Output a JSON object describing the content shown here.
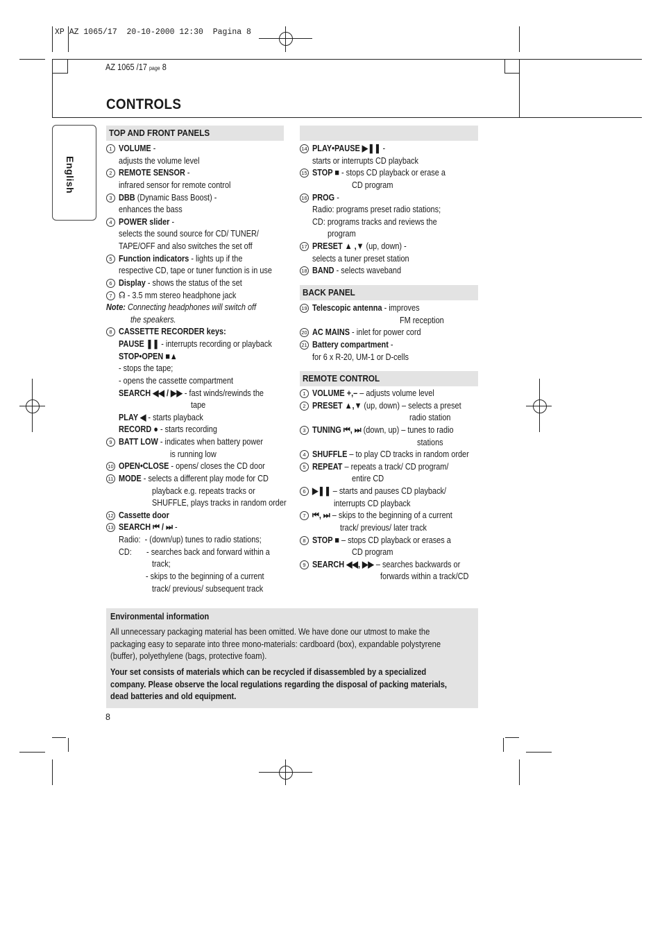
{
  "slug": "XP AZ 1065/17  20-10-2000 12:30  Pagina 8",
  "page_ref": {
    "model": "AZ 1065 /17 ",
    "page_word": "page",
    "page": " 8"
  },
  "title": "CONTROLS",
  "language_tab": "English",
  "left": {
    "header": "TOP AND FRONT PANELS",
    "lines": [
      {
        "n": "1",
        "b": "VOLUME",
        "t": " -"
      },
      {
        "t": "adjusts the volume level"
      },
      {
        "n": "2",
        "b": "REMOTE SENSOR",
        "t": " -"
      },
      {
        "t": "infrared sensor for remote control"
      },
      {
        "n": "3",
        "b": "DBB",
        "t": " (Dynamic Bass Boost) -"
      },
      {
        "t": "enhances the bass"
      },
      {
        "n": "4",
        "b": "POWER slider",
        "t": " -"
      },
      {
        "t": "selects the sound source for CD/ TUNER/"
      },
      {
        "t": "TAPE/OFF and also switches the set off"
      },
      {
        "n": "5",
        "b": "Function indicators",
        "t": " - lights up if the"
      },
      {
        "t": "respective CD, tape or tuner function is in use"
      },
      {
        "n": "6",
        "b": "Display",
        "t": " - shows the status of the set"
      },
      {
        "n": "7",
        "t": "☊ - 3.5 mm stereo headphone jack"
      },
      {
        "note": true,
        "b": "Note:",
        "t": " Connecting headphones will switch off"
      },
      {
        "ind": 17,
        "it": true,
        "t": "the speakers."
      },
      {
        "n": "8",
        "b": "CASSETTE RECORDER keys:"
      },
      {
        "b": "PAUSE ❚❚",
        "t": " - interrupts recording or playback"
      },
      {
        "b": "STOP•OPEN ■▲"
      },
      {
        "t": "- stops the tape;"
      },
      {
        "t": "- opens the cassette compartment"
      },
      {
        "b": "SEARCH ◀◀ / ▶▶",
        "t": " - fast winds/rewinds the"
      },
      {
        "ind": 104,
        "t": "tape"
      },
      {
        "b": "PLAY ◀",
        "t": " - starts playback"
      },
      {
        "b": "RECORD ●",
        "t": " - starts recording"
      },
      {
        "n": "9",
        "b": "BATT LOW",
        "t": " - indicates when battery power"
      },
      {
        "ind": 74,
        "t": "is running low"
      },
      {
        "n": "10",
        "b": "OPEN•CLOSE",
        "t": " - opens/ closes the CD door"
      },
      {
        "n": "11",
        "b": "MODE",
        "t": " - selects a different play mode for CD"
      },
      {
        "ind": 48,
        "t": "playback e.g. repeats tracks or"
      },
      {
        "ind": 48,
        "t": "SHUFFLE, plays tracks in random order"
      },
      {
        "n": "12",
        "b": "Cassette door"
      },
      {
        "n": "13",
        "b": "SEARCH ⏮ / ⏭",
        "t": " -"
      },
      {
        "t": "Radio:  - (down/up) tunes to radio stations;"
      },
      {
        "t": "CD:       - searches back and forward within a"
      },
      {
        "ind": 48,
        "t": "track;"
      },
      {
        "ind": 39,
        "t": "- skips to the beginning of a current"
      },
      {
        "ind": 48,
        "t": "track/ previous/ subsequent track"
      }
    ]
  },
  "right": {
    "header": "",
    "lines": [
      {
        "n": "14",
        "b": "PLAY•PAUSE ▶❚❚",
        "t": " -"
      },
      {
        "t": "starts or interrupts CD playback"
      },
      {
        "n": "15",
        "b": "STOP ■",
        "t": " - stops CD playback or erase a"
      },
      {
        "ind": 57,
        "t": "CD program"
      },
      {
        "n": "16",
        "b": "PROG",
        "t": " -"
      },
      {
        "t": "Radio: programs preset radio stations;"
      },
      {
        "t": "CD: programs tracks and reviews the"
      },
      {
        "ind": 22,
        "t": "program"
      },
      {
        "n": "17",
        "b": "PRESET ▲ ,▼",
        "t": " (up, down) -"
      },
      {
        "t": "selects a tuner preset station"
      },
      {
        "n": "18",
        "b": "BAND",
        "t": " - selects waveband"
      }
    ]
  },
  "back": {
    "header": "BACK PANEL",
    "lines": [
      {
        "n": "19",
        "b": "Telescopic antenna",
        "t": " - improves"
      },
      {
        "ind": 126,
        "t": "FM reception"
      },
      {
        "n": "20",
        "b": "AC MAINS",
        "t": " - inlet for power cord"
      },
      {
        "n": "21",
        "b": "Battery compartment",
        "t": " -"
      },
      {
        "t": "for 6 x R-20, UM-1 or D-cells"
      }
    ]
  },
  "remote": {
    "header": "REMOTE CONTROL",
    "lines": [
      {
        "n": "1",
        "b": "VOLUME +,–",
        "t": " – adjusts volume level"
      },
      {
        "n": "2",
        "b": "PRESET ▲,▼",
        "t": " (up, down) – selects a preset"
      },
      {
        "ind": 140,
        "t": "radio station"
      },
      {
        "n": "3",
        "b": "TUNING ⏮, ⏭",
        "t": " (down, up) – tunes to radio"
      },
      {
        "ind": 151,
        "t": "stations"
      },
      {
        "n": "4",
        "b": "SHUFFLE",
        "t": " – to play CD tracks in random order"
      },
      {
        "n": "5",
        "b": "REPEAT",
        "t": " – repeats a track/ CD program/"
      },
      {
        "ind": 57,
        "t": "entire CD"
      },
      {
        "n": "6",
        "b": "▶❚❚",
        "t": " – starts and pauses CD playback/"
      },
      {
        "ind": 31,
        "t": "interrupts CD playback"
      },
      {
        "n": "7",
        "b": "⏮, ⏭",
        "t": " – skips to the beginning of a current"
      },
      {
        "ind": 40,
        "t": "track/ previous/ later track"
      },
      {
        "n": "8",
        "b": "STOP ■",
        "t": " – stops CD playback or erases a"
      },
      {
        "ind": 57,
        "t": "CD program"
      },
      {
        "n": "9",
        "b": "SEARCH ◀◀, ▶▶",
        "t": " – searches backwards or"
      },
      {
        "ind": 98,
        "t": "forwards within a track/CD"
      }
    ]
  },
  "environment": {
    "title": "Environmental information",
    "body": "All unnecessary packaging material has been omitted. We have done our utmost to make the packaging easy to separate into three mono-materials: cardboard (box), expandable polystyrene (buffer), polyethylene (bags, protective foam).",
    "warning": "Your set consists of materials which can be recycled if disassembled by a specialized company. Please observe the local regulations regarding the disposal of packing materials, dead batteries and old equipment."
  },
  "page_number": "8"
}
